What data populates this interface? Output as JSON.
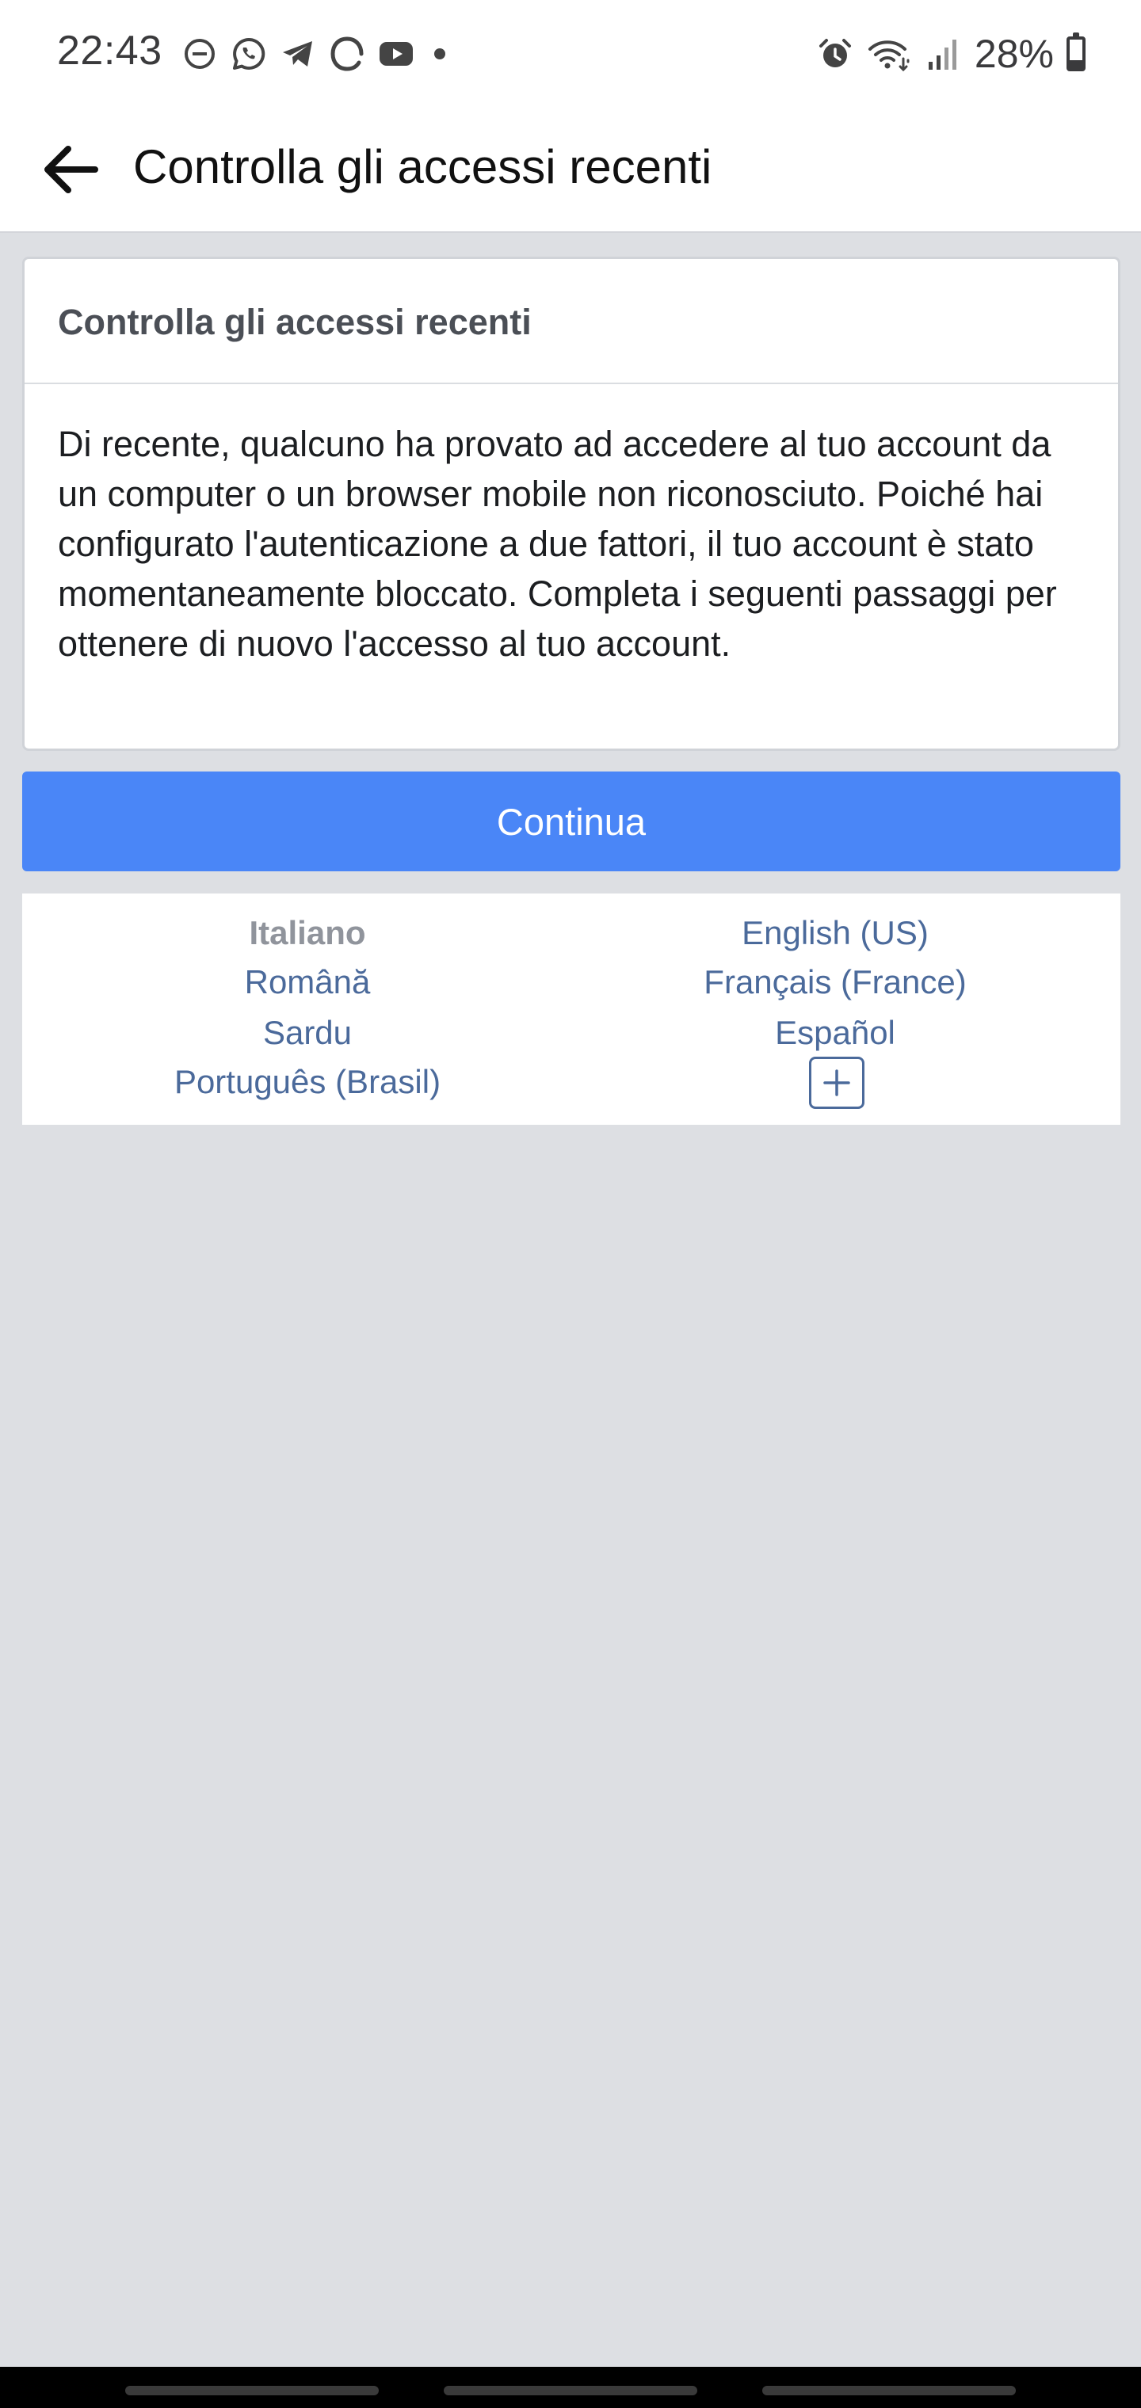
{
  "status_bar": {
    "time": "22:43",
    "icons_left": [
      "do-not-disturb-icon",
      "whatsapp-icon",
      "telegram-icon",
      "threads-icon",
      "youtube-icon",
      "notification-dot-icon"
    ],
    "icons_right": [
      "alarm-icon",
      "wifi-icon",
      "signal-icon",
      "battery-icon"
    ],
    "battery_percent": "28%",
    "battery_level": 0.28
  },
  "app_bar": {
    "back_icon": "arrow-left-icon",
    "title": "Controlla gli accessi recenti"
  },
  "card": {
    "heading": "Controlla gli accessi recenti",
    "body": "Di recente, qualcuno ha provato ad accedere al tuo account da un computer o un browser mobile non riconosciuto. Poiché hai configurato l'autenticazione a due fattori, il tuo account è stato momentaneamente bloccato. Completa i seguenti passaggi per ottenere di nuovo l'accesso al tuo account."
  },
  "continue_button": {
    "label": "Continua"
  },
  "languages": {
    "current": "Italiano",
    "items": [
      "English (US)",
      "Română",
      "Français (France)",
      "Sardu",
      "Español",
      "Português (Brasil)"
    ],
    "more_icon": "plus-icon"
  },
  "colors": {
    "primary_button": "#4a86f7",
    "link": "#4b6a9b",
    "page_background": "#dddfe3"
  }
}
